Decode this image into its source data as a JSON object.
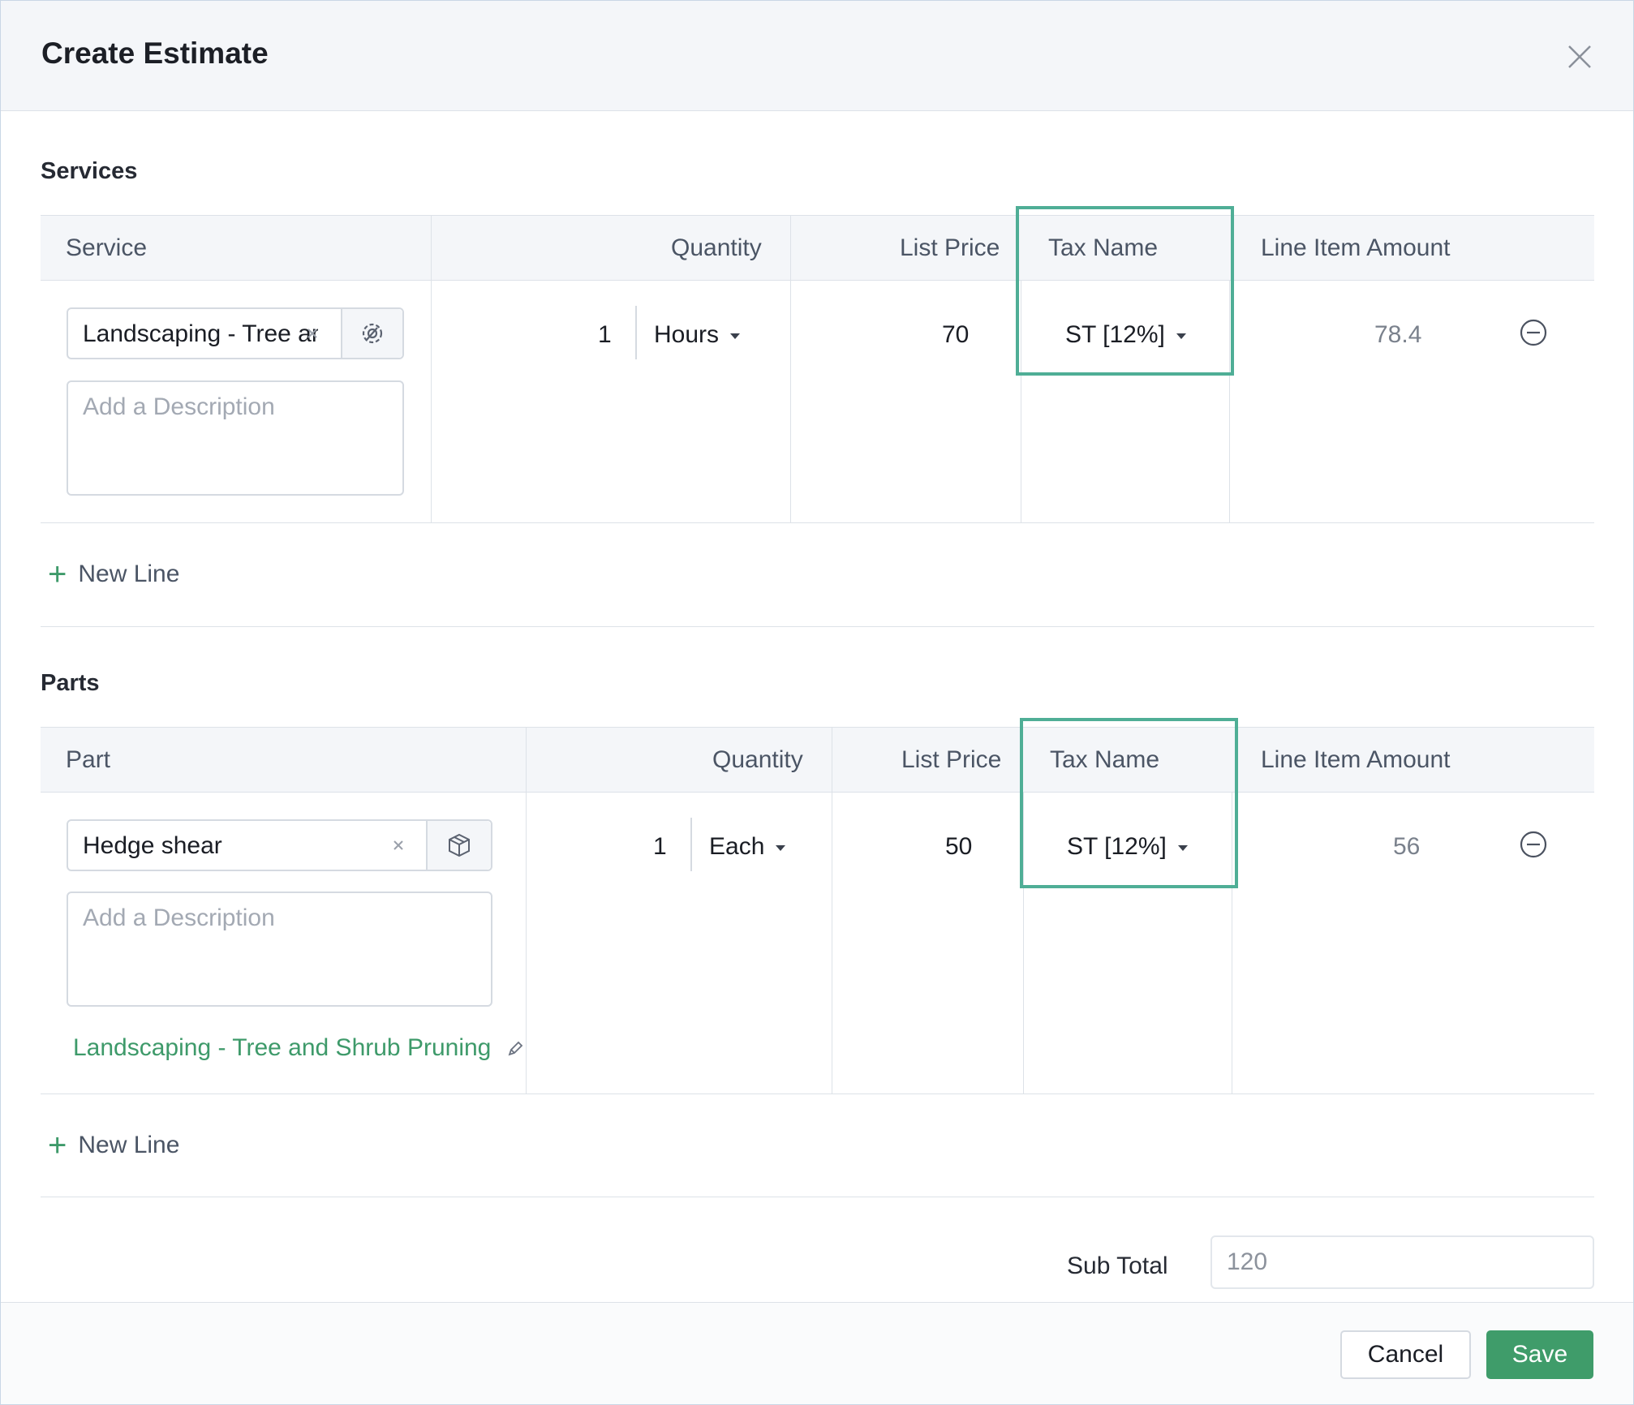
{
  "header": {
    "title": "Create Estimate",
    "close_icon": "close-icon"
  },
  "services": {
    "title": "Services",
    "columns": {
      "item": "Service",
      "quantity": "Quantity",
      "list_price": "List Price",
      "tax_name": "Tax Name",
      "amount": "Line Item Amount"
    },
    "row": {
      "name": "Landscaping - Tree and",
      "description_placeholder": "Add a Description",
      "quantity": "1",
      "unit": "Hours",
      "list_price": "70",
      "tax": "ST [12%]",
      "amount": "78.4"
    },
    "new_line_label": "New Line"
  },
  "parts": {
    "title": "Parts",
    "columns": {
      "item": "Part",
      "quantity": "Quantity",
      "list_price": "List Price",
      "tax_name": "Tax Name",
      "amount": "Line Item Amount"
    },
    "row": {
      "name": "Hedge shear",
      "description_placeholder": "Add a Description",
      "linked_service": "Landscaping - Tree and Shrub Pruning",
      "quantity": "1",
      "unit": "Each",
      "list_price": "50",
      "tax": "ST [12%]",
      "amount": "56"
    },
    "new_line_label": "New Line"
  },
  "summary": {
    "subtotal_label": "Sub Total",
    "subtotal_value": "120"
  },
  "footer": {
    "cancel_label": "Cancel",
    "save_label": "Save"
  },
  "colors": {
    "accent": "#3f9c6a",
    "highlight": "#4fae96",
    "header_bg": "#f4f6f9"
  }
}
